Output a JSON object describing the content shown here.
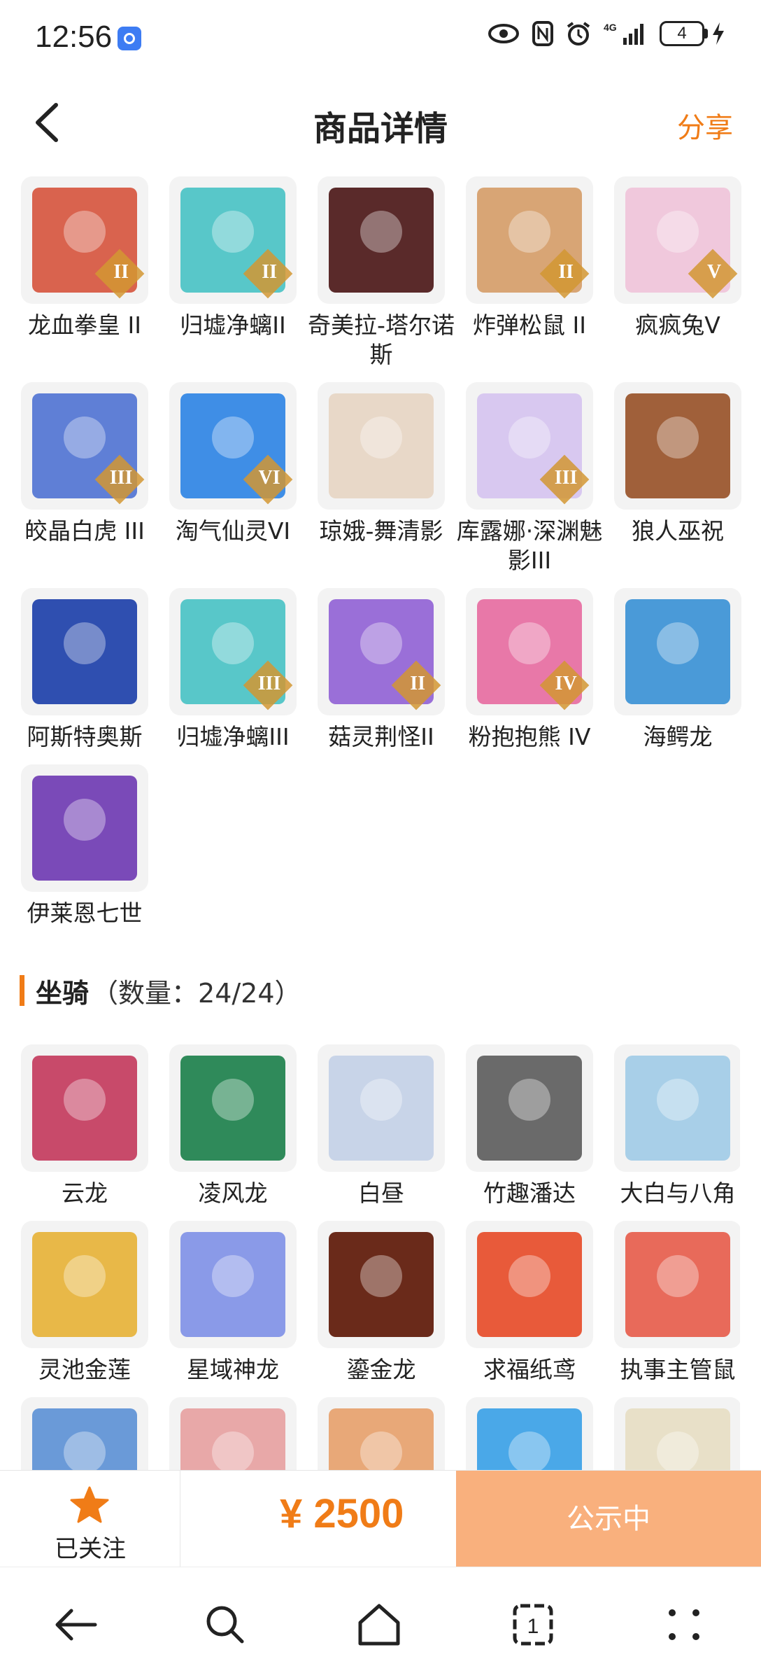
{
  "status_bar": {
    "time": "12:56",
    "network": "4G",
    "battery": "4"
  },
  "header": {
    "title": "商品详情",
    "share_label": "分享"
  },
  "pets": [
    {
      "name": "龙血拳皇 II",
      "tier": "II",
      "color": "#d9634e"
    },
    {
      "name": "归墟净螭II",
      "tier": "II",
      "color": "#58c7c9"
    },
    {
      "name": "奇美拉-塔尔诺斯",
      "tier": "",
      "color": "#5a2a2a"
    },
    {
      "name": "炸弹松鼠 II",
      "tier": "II",
      "color": "#d8a575"
    },
    {
      "name": "疯疯兔V",
      "tier": "V",
      "color": "#f0c8dc"
    },
    {
      "name": "皎晶白虎 III",
      "tier": "III",
      "color": "#5f7fd6"
    },
    {
      "name": "淘气仙灵VI",
      "tier": "VI",
      "color": "#3f8ee6"
    },
    {
      "name": "琼娥-舞清影",
      "tier": "",
      "color": "#e8d8c8"
    },
    {
      "name": "库露娜·深渊魅影III",
      "tier": "III",
      "color": "#d8c8f0"
    },
    {
      "name": "狼人巫祝",
      "tier": "",
      "color": "#a0603a"
    },
    {
      "name": "阿斯特奥斯",
      "tier": "",
      "color": "#2f4fb0"
    },
    {
      "name": "归墟净螭III",
      "tier": "III",
      "color": "#58c7c9"
    },
    {
      "name": "菇灵荆怪II",
      "tier": "II",
      "color": "#9a6fd8"
    },
    {
      "name": "粉抱抱熊 IV",
      "tier": "IV",
      "color": "#e878a8"
    },
    {
      "name": "海鳄龙",
      "tier": "",
      "color": "#4a9ad8"
    },
    {
      "name": "伊莱恩七世",
      "tier": "",
      "color": "#7a4ab8"
    }
  ],
  "mounts_section": {
    "title": "坐骑",
    "count": "（数量：24/24）"
  },
  "mounts": [
    {
      "name": "云龙",
      "color": "#c84a6a"
    },
    {
      "name": "凌风龙",
      "color": "#2f8a5a"
    },
    {
      "name": "白昼",
      "color": "#c8d4e8"
    },
    {
      "name": "竹趣潘达",
      "color": "#6a6a6a"
    },
    {
      "name": "大白与八角",
      "color": "#a8cfe8"
    },
    {
      "name": "灵池金莲",
      "color": "#e8b848"
    },
    {
      "name": "星域神龙",
      "color": "#8a9ae8"
    },
    {
      "name": "鎏金龙",
      "color": "#6a2a1a"
    },
    {
      "name": "求福纸鸢",
      "color": "#e85a3a"
    },
    {
      "name": "执事主管鼠",
      "color": "#e86a5a"
    },
    {
      "name": "",
      "color": "#6a9ad8"
    },
    {
      "name": "",
      "color": "#e8a8a8"
    },
    {
      "name": "",
      "color": "#e8a878"
    },
    {
      "name": "",
      "color": "#4aa8e8"
    },
    {
      "name": "",
      "color": "#e8e0c8"
    }
  ],
  "action_bar": {
    "follow_label": "已关注",
    "price": "¥ 2500",
    "buy_label": "公示中"
  },
  "colors": {
    "accent": "#f07c17",
    "buy_button": "#f9b07d"
  }
}
